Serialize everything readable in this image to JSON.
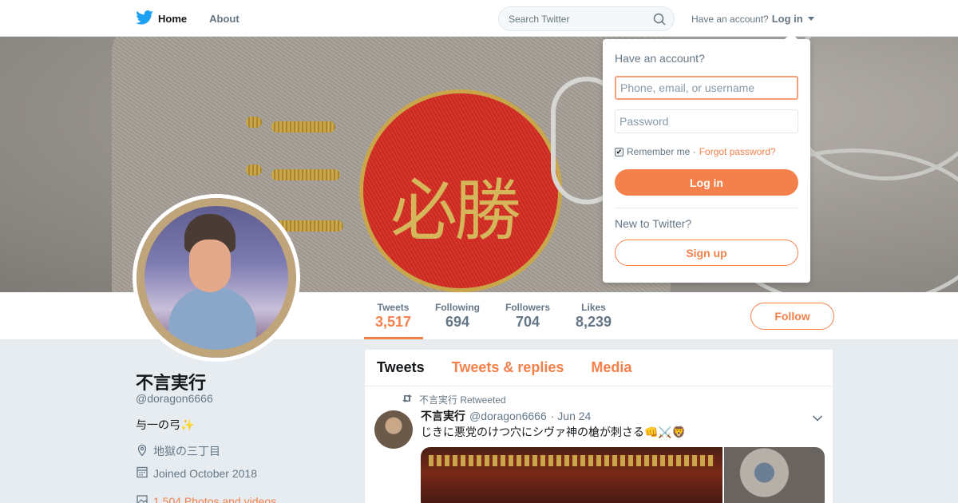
{
  "nav": {
    "home_label": "Home",
    "about_label": "About",
    "search_placeholder": "Search Twitter",
    "have_account_text": "Have an account?",
    "login_label": "Log in"
  },
  "profile": {
    "name": "不言実行",
    "handle": "@doragon6666",
    "bio": "与一の弓✨",
    "location": "地獄の三丁目",
    "joined": "Joined October 2018",
    "photos_link": "1,504 Photos and videos"
  },
  "stats": [
    {
      "label": "Tweets",
      "value": "3,517"
    },
    {
      "label": "Following",
      "value": "694"
    },
    {
      "label": "Followers",
      "value": "704"
    },
    {
      "label": "Likes",
      "value": "8,239"
    }
  ],
  "follow_label": "Follow",
  "banner": {
    "emblem_text": "必勝"
  },
  "timeline": {
    "tabs": [
      "Tweets",
      "Tweets & replies",
      "Media"
    ],
    "tweet": {
      "retweet_text": "不言実行 Retweeted",
      "author_name": "不言実行",
      "author_handle": "@doragon6666",
      "date": "· Jun 24",
      "text": "じきに悪党のけつ穴にシヴァ神の槍が刺さる👊⚔️🦁"
    }
  },
  "login_dropdown": {
    "title": "Have an account?",
    "username_placeholder": "Phone, email, or username",
    "password_placeholder": "Password",
    "remember_label": "Remember me ·",
    "forgot_label": "Forgot password?",
    "login_button": "Log in",
    "new_text": "New to Twitter?",
    "signup_button": "Sign up"
  },
  "colors": {
    "accent": "#f4814b",
    "twitter_blue": "#1da1f2"
  }
}
